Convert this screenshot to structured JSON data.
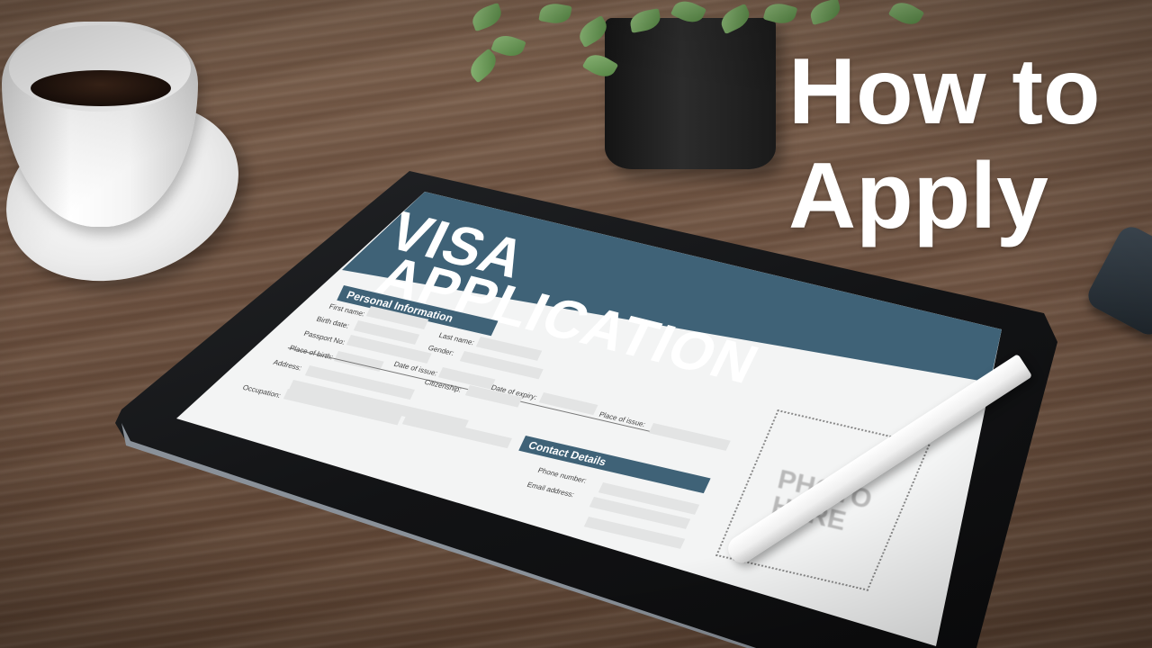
{
  "headline": {
    "line1": "How to",
    "line2": "Apply"
  },
  "tablet_screen": {
    "title_line1": "VISA",
    "title_line2": "APPLICATION",
    "section_personal": "Personal Information",
    "section_contact": "Contact Details",
    "labels": {
      "first_name": "First name:",
      "last_name": "Last name:",
      "birth_date": "Birth date:",
      "gender": "Gender:",
      "passport_no": "Passport No:",
      "place_of_birth": "Place of birth:",
      "date_of_issue": "Date of issue:",
      "address": "Address:",
      "citizenship": "Citizenship:",
      "date_of_expiry": "Date of expiry:",
      "occupation": "Occupation:",
      "place_of_issue": "Place of issue:",
      "phone_number": "Phone number:",
      "email_address": "Email address:"
    },
    "photo_placeholder": "PHOTO\nHERE",
    "accent_color": "#3f6277"
  },
  "scene_objects": [
    "coffee-cup-icon",
    "plant-icon",
    "tablet-icon",
    "stylus-icon",
    "phone-icon"
  ]
}
